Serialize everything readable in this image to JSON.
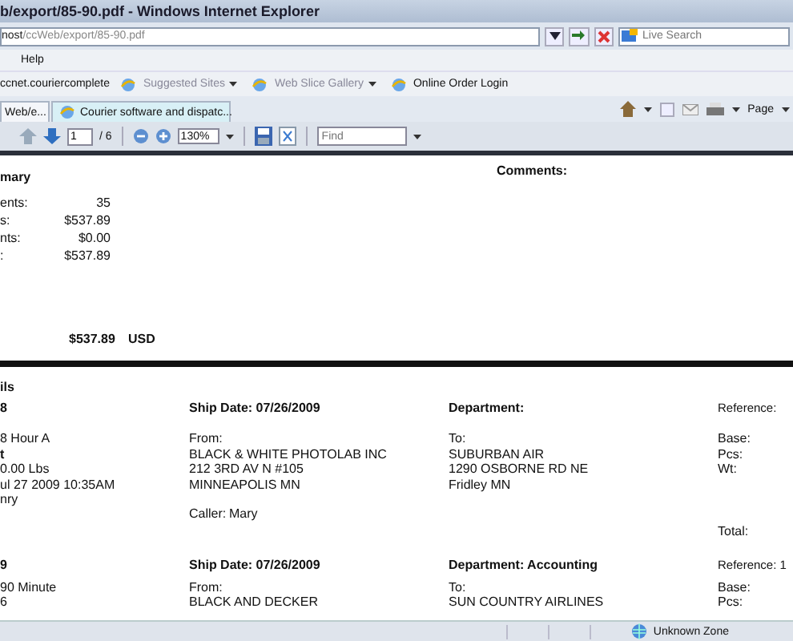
{
  "window": {
    "title": "b/export/85-90.pdf - Windows Internet Explorer"
  },
  "address": {
    "host": "nost",
    "path": "/ccWeb/export/85-90.pdf"
  },
  "search": {
    "placeholder": "Live Search"
  },
  "menu": [
    "Help"
  ],
  "favorites": [
    {
      "label": "ccnet.couriercomplete",
      "dropdown": false,
      "icon": false
    },
    {
      "label": "Suggested Sites",
      "dropdown": true,
      "icon": true
    },
    {
      "label": "Web Slice Gallery",
      "dropdown": true,
      "icon": true
    },
    {
      "label": "Online Order Login",
      "dropdown": false,
      "icon": true
    }
  ],
  "tabs": [
    {
      "label": "Web/e...",
      "selected": true
    },
    {
      "label": "Courier software and dispatc...",
      "selected": false
    }
  ],
  "command_bar": {
    "page": "Page"
  },
  "pdf_toolbar": {
    "page": "1",
    "pages": "/ 6",
    "zoom": "130%",
    "find_placeholder": "Find"
  },
  "summary": {
    "title": "mary",
    "comments_label": "Comments:",
    "rows": [
      {
        "label": "ents:",
        "value": "35"
      },
      {
        "label": "s:",
        "value": "$537.89"
      },
      {
        "label": "nts:",
        "value": "$0.00"
      },
      {
        "label": ":",
        "value": "$537.89"
      }
    ],
    "total": "$537.89",
    "currency": "USD"
  },
  "details": {
    "title": "ils",
    "orders": [
      {
        "id": "8",
        "ship_date": "Ship Date: 07/26/2009",
        "department": "Department:",
        "reference": "Reference:",
        "col1": [
          {
            "text": "8 Hour A",
            "bold": false
          },
          {
            "text": "t",
            "bold": true
          },
          {
            "text": "0.00 Lbs",
            "bold": false
          },
          {
            "text": "ul 27 2009 10:35AM",
            "bold": false
          },
          {
            "text": "nry",
            "bold": false
          }
        ],
        "col2": [
          "From:",
          "BLACK & WHITE PHOTOLAB INC",
          "212 3RD AV N #105",
          "MINNEAPOLIS MN"
        ],
        "col3": [
          "To:",
          "SUBURBAN AIR",
          "1290 OSBORNE RD NE",
          "Fridley MN"
        ],
        "col4": [
          "Base:",
          "Pcs:",
          "Wt:"
        ],
        "caller_label": "Caller:",
        "caller": "Mary",
        "total_label": "Total:"
      },
      {
        "id": "9",
        "ship_date": "Ship Date: 07/26/2009",
        "department": "Department: Accounting",
        "reference": "Reference: 1",
        "col1": [
          {
            "text": "90 Minute",
            "bold": false
          },
          {
            "text": "6",
            "bold": false
          }
        ],
        "col2": [
          "From:",
          "BLACK AND DECKER"
        ],
        "col3": [
          "To:",
          "SUN COUNTRY AIRLINES"
        ],
        "col4": [
          "Base:",
          "Pcs:"
        ]
      }
    ]
  },
  "status_bar": {
    "zone": "Unknown Zone"
  }
}
